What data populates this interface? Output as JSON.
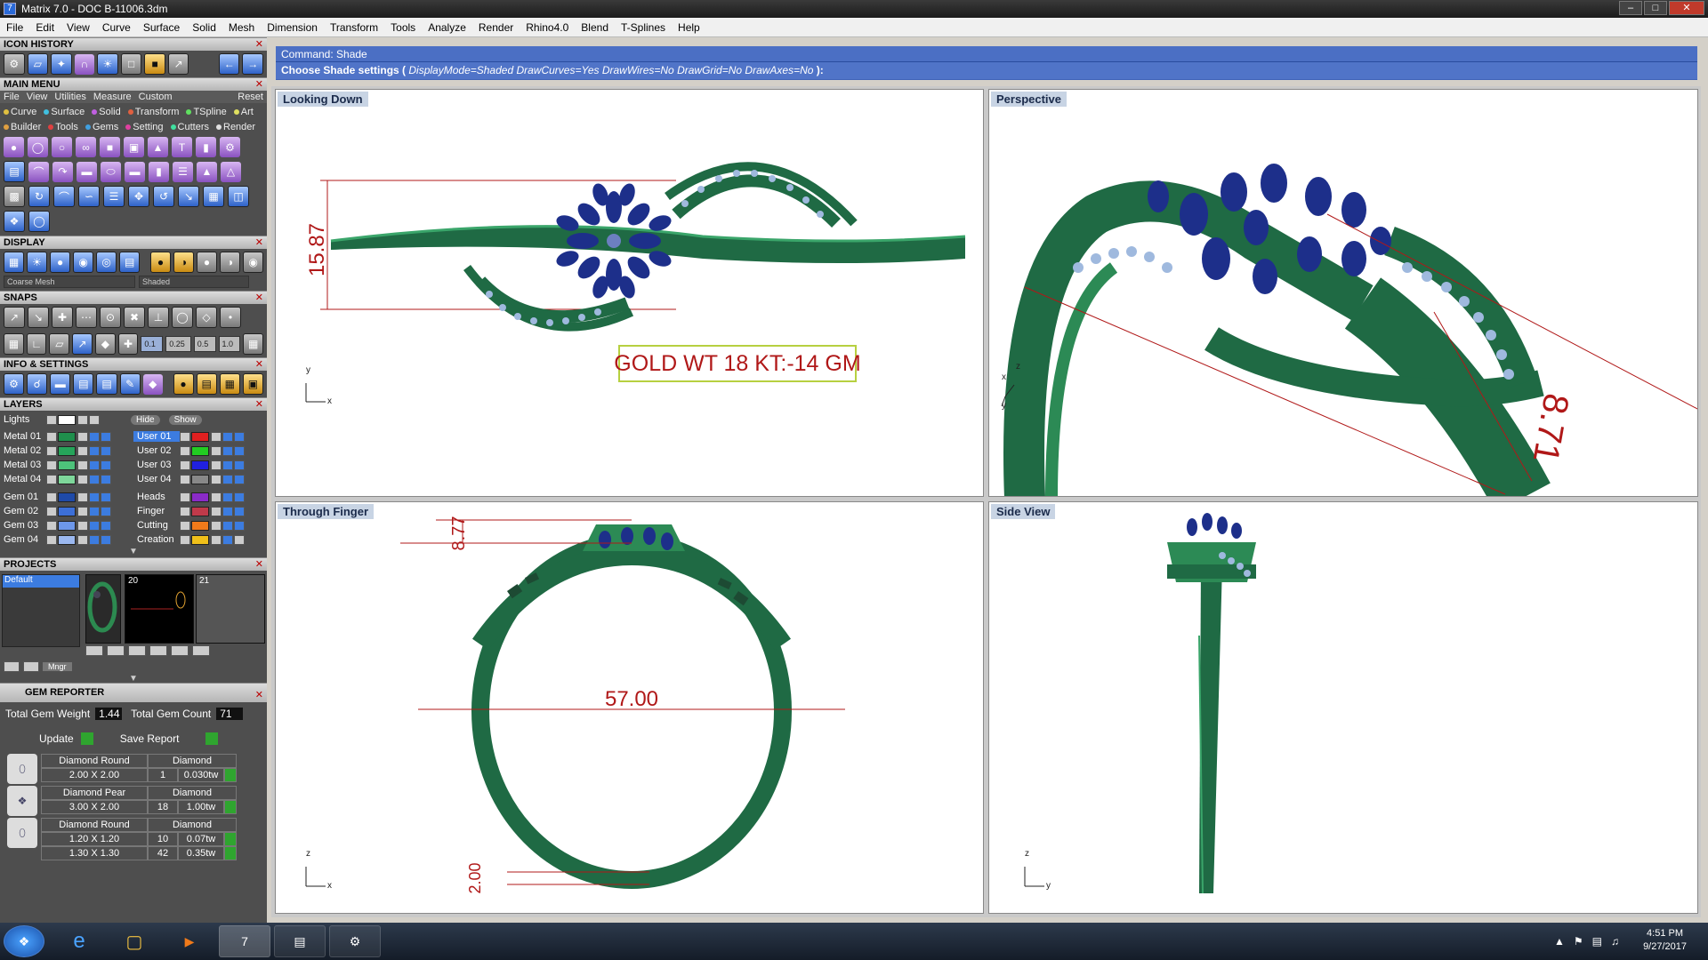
{
  "window": {
    "title": "Matrix 7.0 - DOC B-11006.3dm"
  },
  "menubar": [
    "File",
    "Edit",
    "View",
    "Curve",
    "Surface",
    "Solid",
    "Mesh",
    "Dimension",
    "Transform",
    "Tools",
    "Analyze",
    "Render",
    "Rhino4.0",
    "Blend",
    "T-Splines",
    "Help"
  ],
  "panels": {
    "icon_history": "ICON HISTORY",
    "main_menu": "MAIN MENU",
    "main_menu_tabs": [
      "File",
      "View",
      "Utilities",
      "Measure",
      "Custom"
    ],
    "main_menu_reset": "Reset",
    "cat_row1": [
      "Curve",
      "Surface",
      "Solid",
      "Transform",
      "TSpline",
      "Art"
    ],
    "cat_row2": [
      "Builder",
      "Tools",
      "Gems",
      "Setting",
      "Cutters",
      "Render"
    ],
    "display": "DISPLAY",
    "display_mesh": "Coarse Mesh",
    "display_mode": "Shaded",
    "snaps": "SNAPS",
    "snap_values": [
      "0.1",
      "0.25",
      "0.5",
      "1.0"
    ],
    "info_settings": "INFO & SETTINGS",
    "layers": "LAYERS",
    "lights": "Lights",
    "hide": "Hide",
    "show": "Show",
    "projects": "PROJECTS",
    "project_default": "Default",
    "project_nums": [
      "20",
      "21"
    ],
    "mngr": "Mngr"
  },
  "layers_left": [
    {
      "name": "Metal 01",
      "color": "#1f8f4c"
    },
    {
      "name": "Metal 02",
      "color": "#26a45a"
    },
    {
      "name": "Metal 03",
      "color": "#4dc27a"
    },
    {
      "name": "Metal 04",
      "color": "#7ed79a"
    },
    {
      "name": "Gem 01",
      "color": "#1f4aa8"
    },
    {
      "name": "Gem 02",
      "color": "#3c6fd8"
    },
    {
      "name": "Gem 03",
      "color": "#6d97ea"
    },
    {
      "name": "Gem 04",
      "color": "#9bb8f0"
    }
  ],
  "layers_right": [
    {
      "name": "User 01",
      "color": "#e02020"
    },
    {
      "name": "User 02",
      "color": "#22cc22"
    },
    {
      "name": "User 03",
      "color": "#2020e0"
    },
    {
      "name": "User 04",
      "color": "#888888"
    },
    {
      "name": "Heads",
      "color": "#8a2bc8"
    },
    {
      "name": "Finger",
      "color": "#c03a4a"
    },
    {
      "name": "Cutting",
      "color": "#f07a1a"
    },
    {
      "name": "Creation",
      "color": "#f0c01a"
    }
  ],
  "gem_reporter": {
    "title": "GEM REPORTER",
    "weight_label": "Total Gem Weight",
    "weight": "1.44",
    "count_label": "Total Gem Count",
    "count": "71",
    "update": "Update",
    "save": "Save Report",
    "rows": [
      {
        "shape": "Diamond Round",
        "type": "Diamond",
        "size": "2.00 X 2.00",
        "qty": "1",
        "ctw": "0.030tw"
      },
      {
        "shape": "Diamond Pear",
        "type": "Diamond",
        "size": "3.00 X 2.00",
        "qty": "18",
        "ctw": "1.00tw"
      },
      {
        "shape": "Diamond Round",
        "type": "Diamond",
        "size": "1.20 X 1.20",
        "qty": "10",
        "ctw": "0.07tw"
      },
      {
        "shape": "",
        "type": "",
        "size": "1.30 X 1.30",
        "qty": "42",
        "ctw": "0.35tw"
      }
    ]
  },
  "command": {
    "line1": "Command: Shade",
    "prompt": "Choose Shade settings (",
    "options": "DisplayMode=Shaded  DrawCurves=Yes  DrawWires=No  DrawGrid=No  DrawAxes=No",
    "end": " ):"
  },
  "viewports": {
    "top_left": "Looking Down",
    "top_right": "Perspective",
    "bottom_left": "Through Finger",
    "bottom_right": "Side View"
  },
  "annotations": {
    "dim_height": "15.87",
    "gold_weight": "GOLD WT 18 KT:-14 GM",
    "dim_perspective": "8.71",
    "dim_head": "8.77",
    "dim_diameter": "57.00",
    "dim_shank": "2.00"
  },
  "axes": {
    "x": "x",
    "y": "y",
    "z": "z"
  },
  "taskbar": {
    "time": "4:51 PM",
    "date": "9/27/2017"
  },
  "colors": {
    "metal": "#1f6a44",
    "metal_light": "#3aa56a",
    "gem": "#1d2f8a",
    "dim": "#b01818",
    "label_box": "#d6e08a"
  }
}
